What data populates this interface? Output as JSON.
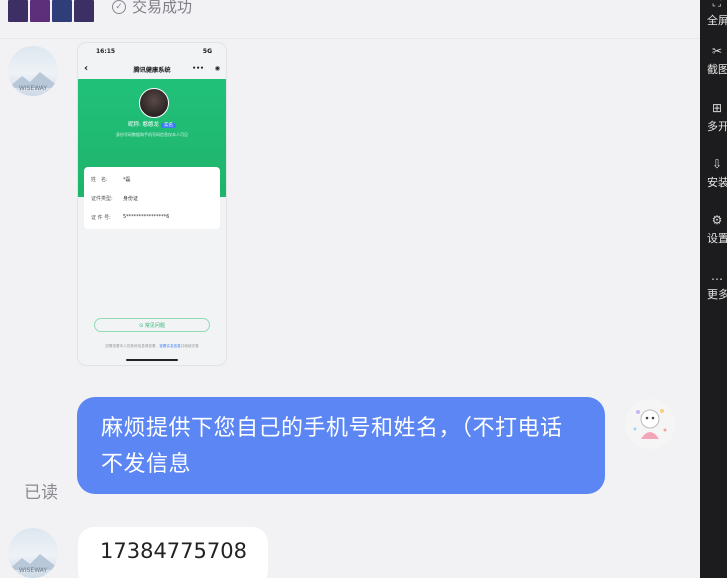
{
  "top": {
    "status_text": "交易成功"
  },
  "screenshot_card": {
    "status_time": "16:15",
    "status_signal": "5G",
    "nav_title": "腾讯健康系统",
    "nav_more": "•••",
    "profile_name": "昵称: 憨憨龙",
    "profile_badge": "实名",
    "profile_sub": "身份号码数据和手机号码信息仅本人可见",
    "rows": [
      {
        "key": "姓　名:",
        "value": "*磊"
      },
      {
        "key": "证件类型:",
        "value": "身份证"
      },
      {
        "key": "证 件 号:",
        "value": "5****************6"
      }
    ],
    "faq_button": "⊙ 常见问题",
    "footer_text": "如需查看本人的其他信息请查看，",
    "footer_link": "查看实名信息",
    "footer_tail": "并继续完善"
  },
  "messages": [
    {
      "type": "outgoing",
      "text_line1": "麻烦提供下您自己的手机号和姓名，（不打电话",
      "text_line2": "不发信息",
      "read_status": "已读"
    },
    {
      "type": "incoming",
      "text": "17384775708"
    }
  ],
  "avatars": {
    "other_brand": "WISEWAY"
  },
  "toolbar": {
    "items": [
      {
        "label": "全屏",
        "icon": "fullscreen-icon"
      },
      {
        "label": "截图",
        "icon": "scissors-icon"
      },
      {
        "label": "多开",
        "icon": "multi-open-icon"
      },
      {
        "label": "安装",
        "icon": "install-icon"
      },
      {
        "label": "设置",
        "icon": "settings-icon"
      },
      {
        "label": "更多",
        "icon": "more-icon"
      }
    ]
  }
}
